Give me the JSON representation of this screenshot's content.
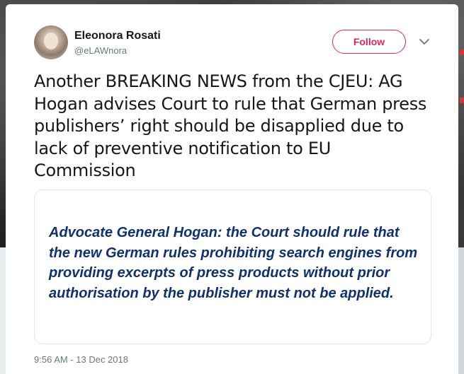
{
  "tweet": {
    "author_name": "Eleonora Rosati",
    "author_handle": "@eLAWnora",
    "follow_label": "Follow",
    "text": "Another BREAKING NEWS from the CJEU: AG Hogan advises Court to rule that German press publishers’ right should be disapplied due to lack of preventive notification to EU Commission",
    "card_text": "Advocate General Hogan: the Court should rule that the new German rules prohibiting search engines from providing excerpts of press products without prior authorisation by the publisher must not be applied.",
    "timestamp": "9:56 AM - 13 Dec 2018"
  },
  "icons": {
    "avatar": "avatar",
    "menu": "chevron-down-icon"
  },
  "colors": {
    "follow_accent": "#e0245e",
    "card_text": "#10316b",
    "secondary_text": "#657786"
  }
}
